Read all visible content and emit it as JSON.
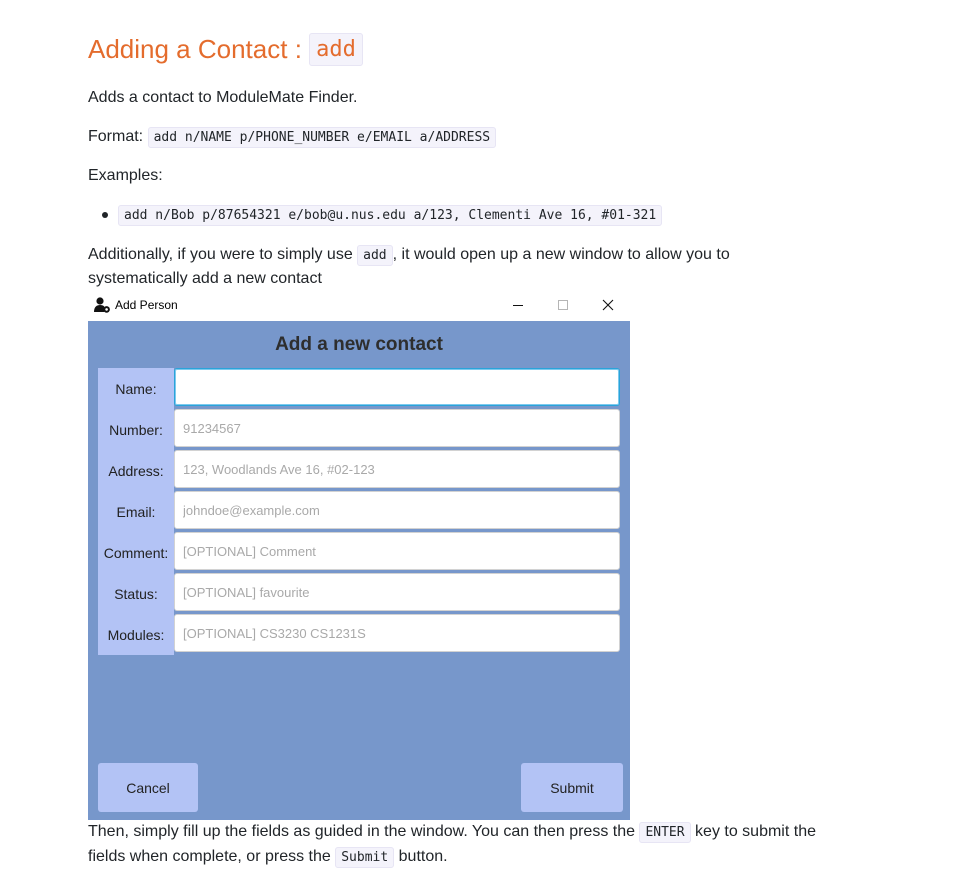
{
  "doc": {
    "heading_text": "Adding a Contact : ",
    "heading_code": "add",
    "intro": "Adds a contact to ModuleMate Finder.",
    "format_label": "Format: ",
    "format_code": "add n/NAME p/PHONE_NUMBER e/EMAIL a/ADDRESS",
    "examples_label": "Examples:",
    "example_code": "add n/Bob p/87654321 e/bob@u.nus.edu a/123, Clementi Ave 16, #01-321",
    "additional_pre": "Additionally, if you were to simply use ",
    "additional_code": "add",
    "additional_post": ", it would open up a new window to allow you to",
    "additional_line2": "systematically add a new contact",
    "then_pre": "Then, simply fill up the fields as guided in the window. You can then press the ",
    "then_code1": "ENTER",
    "then_post": " key to submit the",
    "then_line2_pre": "fields when complete, or press the ",
    "then_code2": "Submit",
    "then_line2_post": " button."
  },
  "window": {
    "title": "Add Person",
    "icon": "user-gear-icon",
    "heading": "Add a new contact",
    "fields": [
      {
        "label": "Name:",
        "placeholder": "",
        "value": ""
      },
      {
        "label": "Number:",
        "placeholder": "91234567",
        "value": ""
      },
      {
        "label": "Address:",
        "placeholder": "123, Woodlands Ave 16, #02-123",
        "value": ""
      },
      {
        "label": "Email:",
        "placeholder": "johndoe@example.com",
        "value": ""
      },
      {
        "label": "Comment:",
        "placeholder": "[OPTIONAL] Comment",
        "value": ""
      },
      {
        "label": "Status:",
        "placeholder": "[OPTIONAL] favourite",
        "value": ""
      },
      {
        "label": "Modules:",
        "placeholder": "[OPTIONAL] CS3230 CS1231S",
        "value": ""
      }
    ],
    "cancel_label": "Cancel",
    "submit_label": "Submit"
  },
  "colors": {
    "heading": "#e46c2d",
    "window_bg": "#7797cb",
    "label_panel": "#b3c3f5",
    "button_bg": "#b3c3f5",
    "focus_border": "#2aa3d9"
  }
}
